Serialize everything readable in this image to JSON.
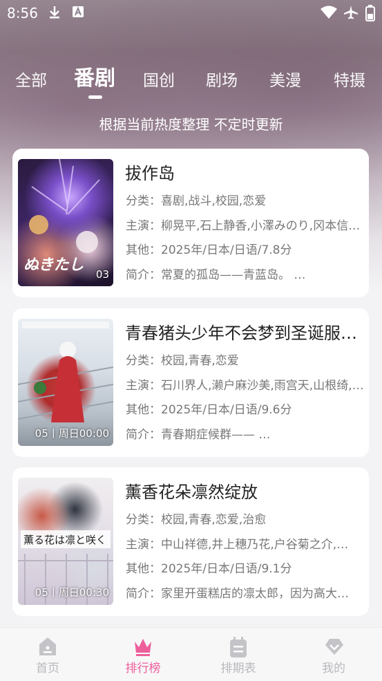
{
  "status_bar": {
    "time": "8:56"
  },
  "tabs": [
    {
      "label": "全部"
    },
    {
      "label": "番剧"
    },
    {
      "label": "国创"
    },
    {
      "label": "剧场"
    },
    {
      "label": "美漫"
    },
    {
      "label": "特摄"
    }
  ],
  "active_tab": "番剧",
  "subtitle": "根据当前热度整理 不定时更新",
  "labels": {
    "category": "分类：",
    "cast": "主演：",
    "other": "其他：",
    "intro": "简介："
  },
  "cards": [
    {
      "title": "拔作岛",
      "category": "喜剧,战斗,校园,恋爱",
      "cast": "柳晃平,石上静香,小澤みのり,冈本信彦,…",
      "other": "2025年/日本/日语/7.8分",
      "intro": "常夏的孤岛——青蓝岛。 …",
      "badge": "03"
    },
    {
      "title": "青春猪头少年不会梦到圣诞服女郎",
      "category": "校园,青春,恋爱",
      "cast": "石川界人,濑户麻沙美,雨宫天,山根绮,…",
      "other": "2025年/日本/日语/9.6分",
      "intro": "青春期症候群—— …",
      "badge": "05丨周日00:00"
    },
    {
      "title": "薰香花朵凛然绽放",
      "category": "校园,青春,恋爱,治愈",
      "cast": "中山祥德,井上穗乃花,户谷菊之介,…",
      "other": "2025年/日本/日语/9.1分",
      "intro": "家里开蛋糕店的凛太郎，因为高大…",
      "badge": "05丨周日00:30"
    }
  ],
  "bottom_nav": [
    {
      "label": "首页",
      "icon": "home-icon"
    },
    {
      "label": "排行榜",
      "icon": "crown-icon"
    },
    {
      "label": "排期表",
      "icon": "calendar-icon"
    },
    {
      "label": "我的",
      "icon": "heart-icon"
    }
  ],
  "colors": {
    "accent": "#ee5e9b",
    "inactive": "#b9b9bd"
  }
}
